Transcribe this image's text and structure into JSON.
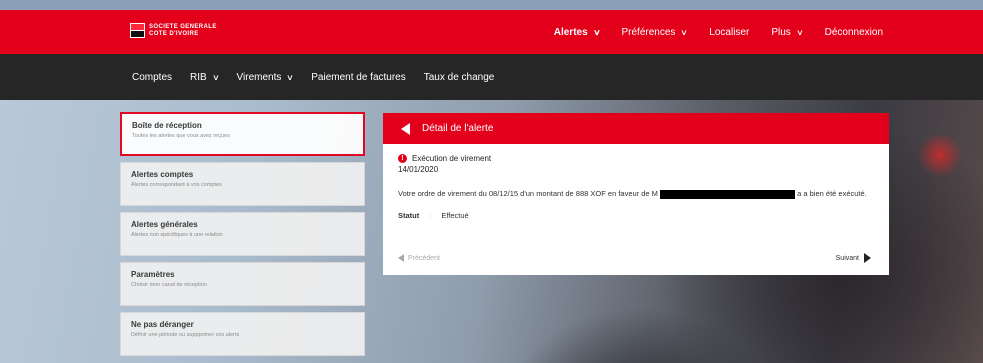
{
  "brand": {
    "logo_line1": "SOCIETE GENERALE",
    "logo_line2": "COTE D'IVOIRE"
  },
  "topnav": {
    "items": [
      {
        "label": "Alertes",
        "has_dropdown": true,
        "active": true
      },
      {
        "label": "Préférences",
        "has_dropdown": true
      },
      {
        "label": "Localiser",
        "has_dropdown": false
      },
      {
        "label": "Plus",
        "has_dropdown": true
      },
      {
        "label": "Déconnexion",
        "has_dropdown": false
      }
    ]
  },
  "subnav": {
    "items": [
      {
        "label": "Comptes",
        "has_dropdown": false
      },
      {
        "label": "RIB",
        "has_dropdown": true
      },
      {
        "label": "Virements",
        "has_dropdown": true
      },
      {
        "label": "Paiement de factures",
        "has_dropdown": false
      },
      {
        "label": "Taux de change",
        "has_dropdown": false
      }
    ]
  },
  "leftmenu": {
    "items": [
      {
        "title": "Boîte de réception",
        "subtitle": "Toutes les alertes que vous avez reçues",
        "active": true
      },
      {
        "title": "Alertes comptes",
        "subtitle": "Alertes correspondant à vos comptes"
      },
      {
        "title": "Alertes générales",
        "subtitle": "Alertes non spécifiques à une relation"
      },
      {
        "title": "Paramètres",
        "subtitle": "Choisir mon canal de réception"
      },
      {
        "title": "Ne pas déranger",
        "subtitle": "Définir une période ou suppprimer vos alerts"
      }
    ]
  },
  "detail": {
    "header_title": "Détail de l'alerte",
    "alert_title": "Exécution de virement",
    "alert_date": "14/01/2020",
    "message_before": "Votre ordre de virement du 08/12/15 d'un montant de 888 XOF en faveur de M",
    "message_after": "a a bien été exécuté.",
    "status_label": "Statut",
    "status_sep": ":",
    "status_value": "Effectué",
    "prev_label": "Précédent",
    "next_label": "Suivant"
  },
  "colors": {
    "brand_red": "#e2001a",
    "subnav_bg": "#262626"
  }
}
